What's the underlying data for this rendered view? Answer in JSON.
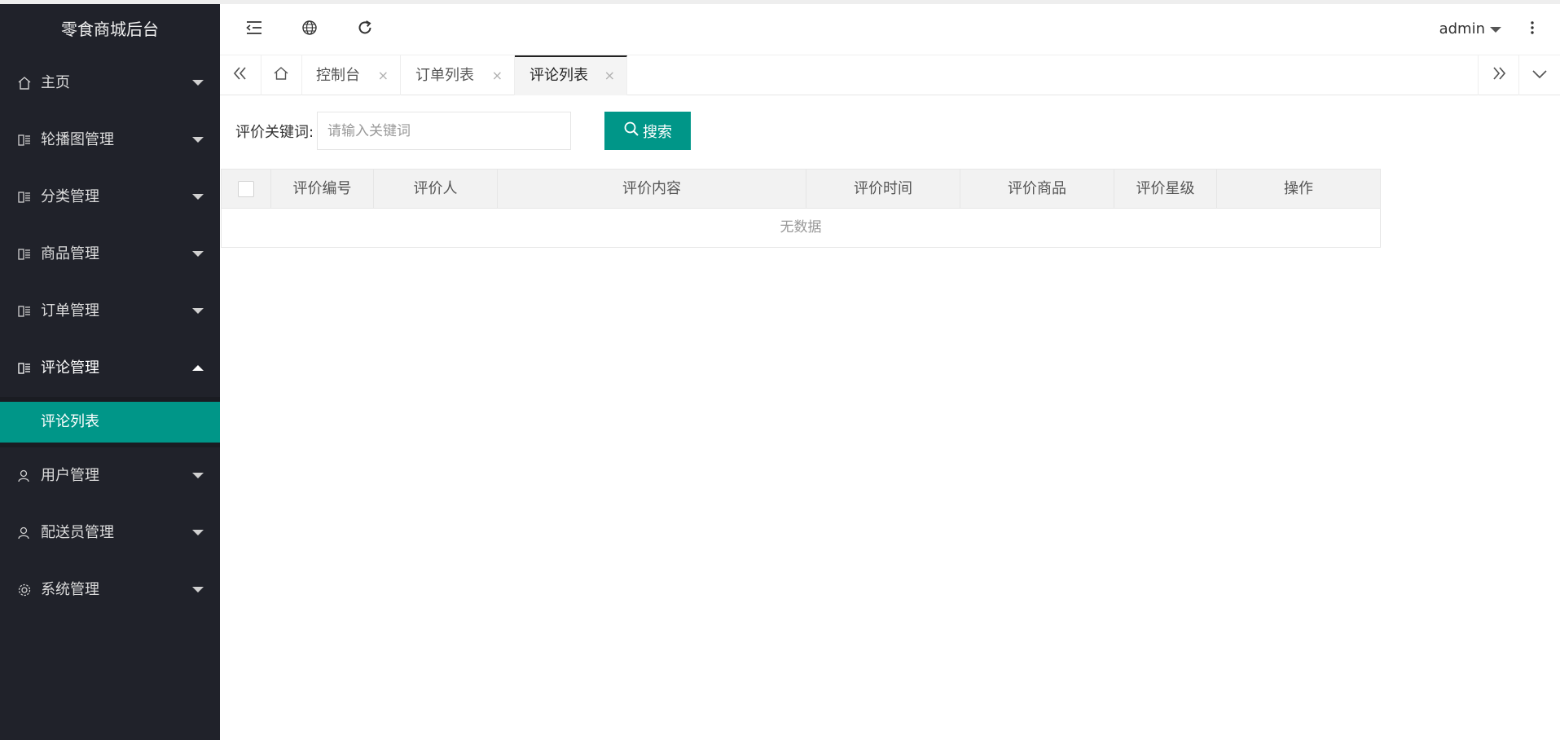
{
  "app": {
    "title": "零食商城后台"
  },
  "sidebar": {
    "items": [
      {
        "label": "主页",
        "icon": "home-icon",
        "open": false
      },
      {
        "label": "轮播图管理",
        "icon": "catalog-icon",
        "open": false
      },
      {
        "label": "分类管理",
        "icon": "catalog-icon",
        "open": false
      },
      {
        "label": "商品管理",
        "icon": "catalog-icon",
        "open": false
      },
      {
        "label": "订单管理",
        "icon": "catalog-icon",
        "open": false
      },
      {
        "label": "评论管理",
        "icon": "catalog-icon",
        "open": true,
        "children": [
          {
            "label": "评论列表",
            "active": true
          }
        ]
      },
      {
        "label": "用户管理",
        "icon": "user-icon",
        "open": false
      },
      {
        "label": "配送员管理",
        "icon": "user-icon",
        "open": false
      },
      {
        "label": "系统管理",
        "icon": "gear-icon",
        "open": false
      }
    ]
  },
  "header": {
    "user": "admin",
    "icons": [
      "collapse-menu-icon",
      "globe-icon",
      "refresh-icon",
      "more-vertical-icon"
    ]
  },
  "tabs": [
    {
      "label": "控制台",
      "active": false
    },
    {
      "label": "订单列表",
      "active": false
    },
    {
      "label": "评论列表",
      "active": true
    }
  ],
  "tab_close_glyph": "×",
  "search": {
    "label": "评价关键词:",
    "placeholder": "请输入关键词",
    "value": "",
    "button_label": "搜索"
  },
  "table": {
    "columns": [
      "评价编号",
      "评价人",
      "评价内容",
      "评价时间",
      "评价商品",
      "评价星级",
      "操作"
    ],
    "rows": [],
    "empty_text": "无数据"
  },
  "colors": {
    "sidebar_bg": "#20222a",
    "accent": "#009688",
    "header_bg": "#ffffff",
    "table_header_bg": "#f2f2f2"
  }
}
